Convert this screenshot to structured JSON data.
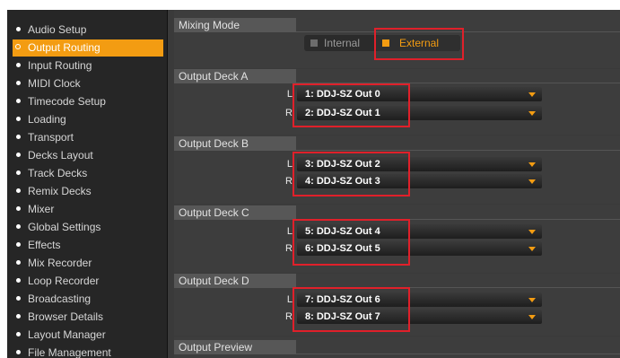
{
  "sidebar": {
    "items": [
      {
        "label": "Audio Setup",
        "active": false
      },
      {
        "label": "Output Routing",
        "active": true
      },
      {
        "label": "Input Routing",
        "active": false
      },
      {
        "label": "MIDI Clock",
        "active": false
      },
      {
        "label": "Timecode Setup",
        "active": false
      },
      {
        "label": "Loading",
        "active": false
      },
      {
        "label": "Transport",
        "active": false
      },
      {
        "label": "Decks Layout",
        "active": false
      },
      {
        "label": "Track Decks",
        "active": false
      },
      {
        "label": "Remix Decks",
        "active": false
      },
      {
        "label": "Mixer",
        "active": false
      },
      {
        "label": "Global Settings",
        "active": false
      },
      {
        "label": "Effects",
        "active": false
      },
      {
        "label": "Mix Recorder",
        "active": false
      },
      {
        "label": "Loop Recorder",
        "active": false
      },
      {
        "label": "Broadcasting",
        "active": false
      },
      {
        "label": "Browser Details",
        "active": false
      },
      {
        "label": "Layout Manager",
        "active": false
      },
      {
        "label": "File Management",
        "active": false
      }
    ]
  },
  "mixing_mode": {
    "header": "Mixing Mode",
    "internal_label": "Internal",
    "external_label": "External",
    "selected": "External"
  },
  "decks": [
    {
      "header": "Output Deck A",
      "left_label": "L",
      "right_label": "R",
      "left_value": "1: DDJ-SZ Out 0",
      "right_value": "2: DDJ-SZ Out 1"
    },
    {
      "header": "Output Deck B",
      "left_label": "L",
      "right_label": "R",
      "left_value": "3: DDJ-SZ Out 2",
      "right_value": "4: DDJ-SZ Out 3"
    },
    {
      "header": "Output Deck C",
      "left_label": "L",
      "right_label": "R",
      "left_value": "5: DDJ-SZ Out 4",
      "right_value": "6: DDJ-SZ Out 5"
    },
    {
      "header": "Output Deck D",
      "left_label": "L",
      "right_label": "R",
      "left_value": "7: DDJ-SZ Out 6",
      "right_value": "8: DDJ-SZ Out 7"
    }
  ],
  "preview": {
    "header": "Output Preview"
  },
  "colors": {
    "accent": "#f39c12",
    "highlight": "#e0202a",
    "sidebar_bg": "#262626",
    "panel_bg": "#3d3d3d"
  }
}
